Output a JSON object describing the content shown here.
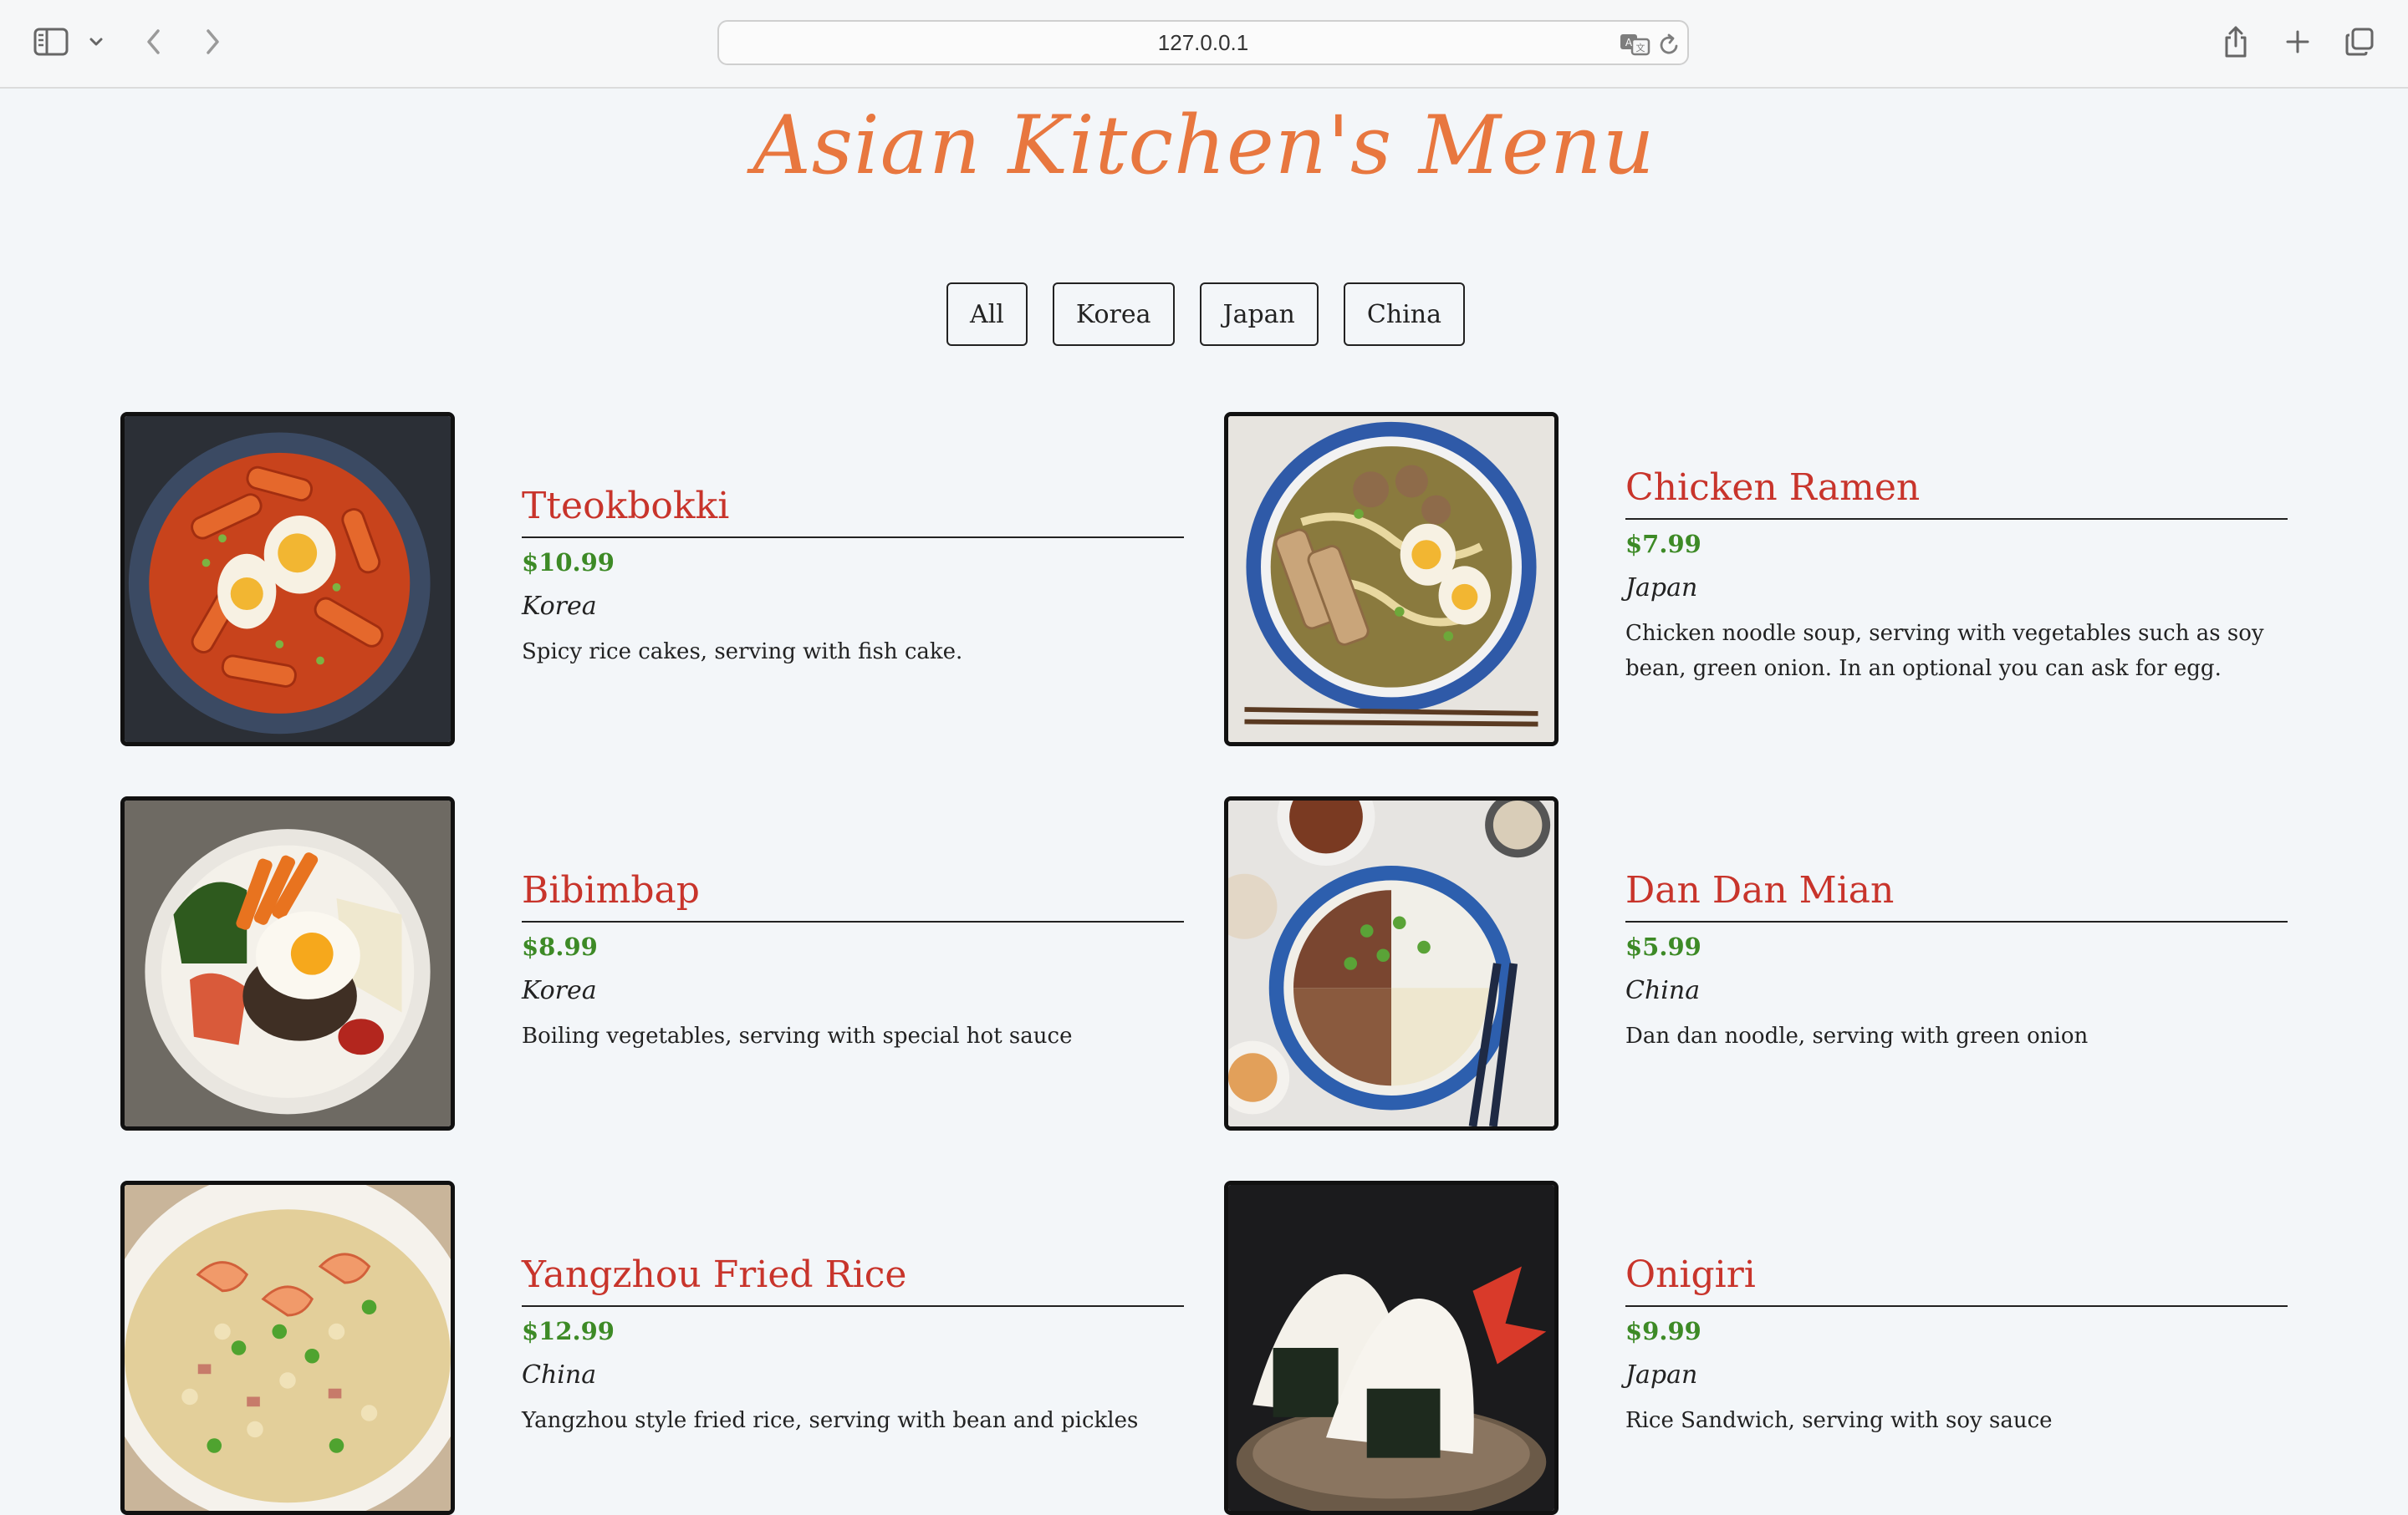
{
  "browser": {
    "address": "127.0.0.1"
  },
  "page": {
    "title": "Asian Kitchen's Menu"
  },
  "filters": [
    "All",
    "Korea",
    "Japan",
    "China"
  ],
  "menu": [
    {
      "name": "Tteokbokki",
      "price": "$10.99",
      "region": "Korea",
      "description": "Spicy rice cakes, serving with fish cake."
    },
    {
      "name": "Chicken Ramen",
      "price": "$7.99",
      "region": "Japan",
      "description": "Chicken noodle soup, serving with vegetables such as soy bean, green onion. In an optional you can ask for egg."
    },
    {
      "name": "Bibimbap",
      "price": "$8.99",
      "region": "Korea",
      "description": "Boiling vegetables, serving with special hot sauce"
    },
    {
      "name": "Dan Dan Mian",
      "price": "$5.99",
      "region": "China",
      "description": "Dan dan noodle, serving with green onion"
    },
    {
      "name": "Yangzhou Fried Rice",
      "price": "$12.99",
      "region": "China",
      "description": "Yangzhou style fried rice, serving with bean and pickles"
    },
    {
      "name": "Onigiri",
      "price": "$9.99",
      "region": "Japan",
      "description": "Rice Sandwich, serving with soy sauce"
    }
  ]
}
